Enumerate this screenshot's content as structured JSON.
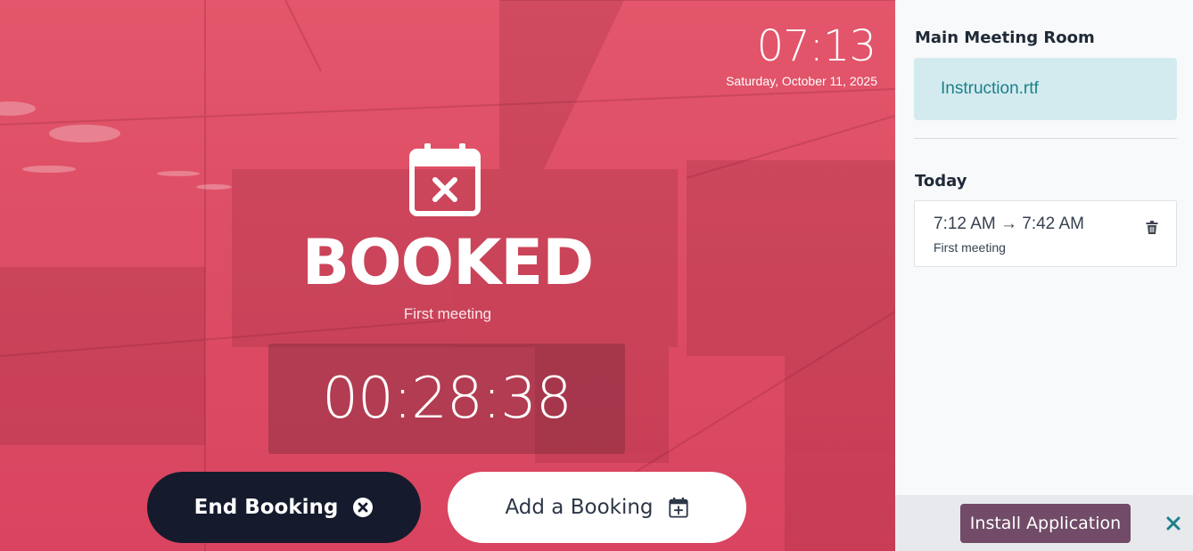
{
  "clock": {
    "time": "07:13",
    "date": "Saturday, October 11, 2025"
  },
  "status": {
    "icon": "calendar-x-icon",
    "title": "BOOKED",
    "meeting_name": "First meeting",
    "countdown": "00:28:38"
  },
  "actions": {
    "end_booking_label": "End Booking",
    "end_booking_icon": "circle-x-icon",
    "add_booking_label": "Add a Booking",
    "add_booking_icon": "calendar-plus-icon"
  },
  "sidebar": {
    "room_name": "Main Meeting Room",
    "attachment": "Instruction.rtf",
    "today_label": "Today",
    "events": [
      {
        "time": "7:12 AM → 7:42 AM",
        "name": "First meeting",
        "icon": "trash-icon"
      }
    ]
  },
  "install_bar": {
    "button_label": "Install Application",
    "close_icon": "close-icon"
  },
  "colors": {
    "booked_accent": "#dc4c63",
    "end_button": "#151b2c",
    "install_button": "#714b67",
    "attachment_bg": "#d3ebef",
    "attachment_text": "#1c7f8a",
    "close_icon": "#1c7f8a"
  }
}
